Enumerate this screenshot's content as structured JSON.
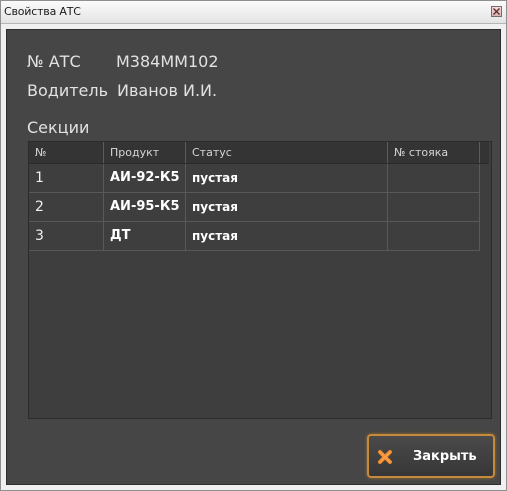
{
  "window": {
    "title": "Свойства АТС"
  },
  "info": {
    "ats_label": "№ АТС",
    "ats_value": "М384ММ102",
    "driver_label": "Водитель",
    "driver_value": "Иванов И.И."
  },
  "sections": {
    "title": "Секции",
    "columns": [
      "№",
      "Продукт",
      "Статус",
      "№ стояка"
    ],
    "rows": [
      {
        "num": "1",
        "product": "АИ-92-К5",
        "status": "пустая",
        "riser": ""
      },
      {
        "num": "2",
        "product": "АИ-95-К5",
        "status": "пустая",
        "riser": ""
      },
      {
        "num": "3",
        "product": "ДТ",
        "status": "пустая",
        "riser": ""
      }
    ]
  },
  "buttons": {
    "close_label": "Закрыть"
  },
  "colors": {
    "accent": "#c58a3c",
    "close_icon": "#f08a30",
    "panel": "#464646"
  }
}
